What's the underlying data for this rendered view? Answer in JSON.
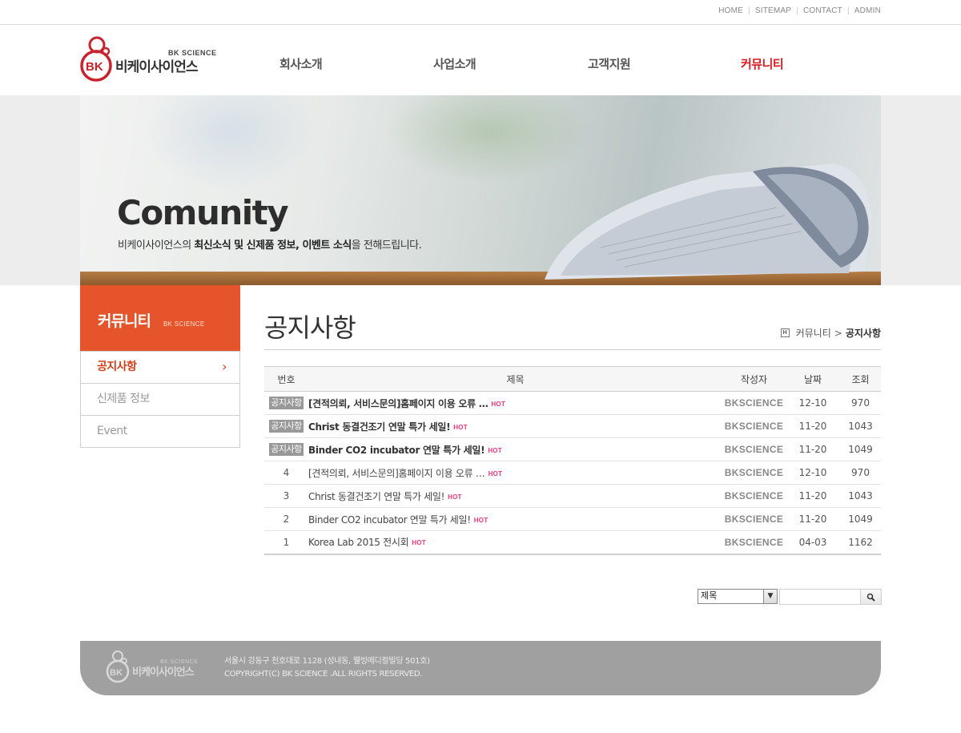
{
  "util_links": [
    "HOME",
    "SITEMAP",
    "CONTACT",
    "ADMIN"
  ],
  "logo": {
    "sub": "BK SCIENCE",
    "ko": "비케이사이언스",
    "mark": "BK"
  },
  "gnb": [
    {
      "label": "회사소개",
      "active": false
    },
    {
      "label": "사업소개",
      "active": false
    },
    {
      "label": "고객지원",
      "active": false
    },
    {
      "label": "커뮤니티",
      "active": true
    }
  ],
  "visual": {
    "title": "Comunity",
    "desc_pre": "비케이사이언스의 ",
    "desc_bold": "최신소식 및 신제품 정보, 이벤트 소식",
    "desc_post": "을 전해드립니다."
  },
  "sidebar": {
    "title_ko": "커뮤니티",
    "title_en": "BK SCIENCE",
    "items": [
      {
        "label": "공지사항",
        "active": true
      },
      {
        "label": "신제품 정보",
        "active": false
      },
      {
        "label": "Event",
        "active": false
      }
    ]
  },
  "content": {
    "title": "공지사항",
    "breadcrumb": {
      "home": "H",
      "parent": "커뮤니티",
      "current": "공지사항"
    }
  },
  "board": {
    "headers": [
      "번호",
      "제목",
      "작성자",
      "날짜",
      "조회"
    ],
    "notice_label": "공지사항",
    "hot_label": "HOT",
    "rows": [
      {
        "num": "공지사항",
        "notice": true,
        "subject": "[견적의뢰, 서비스문의]홈페이지 이용 오류 …",
        "writer": "BKSCIENCE",
        "date": "12-10",
        "views": "970"
      },
      {
        "num": "공지사항",
        "notice": true,
        "subject": "Christ 동결건조기 연말 특가 세일!",
        "writer": "BKSCIENCE",
        "date": "11-20",
        "views": "1043"
      },
      {
        "num": "공지사항",
        "notice": true,
        "subject": "Binder CO2 incubator 연말 특가 세일!",
        "writer": "BKSCIENCE",
        "date": "11-20",
        "views": "1049"
      },
      {
        "num": "4",
        "notice": false,
        "subject": "[견적의뢰, 서비스문의]홈페이지 이용 오류 …",
        "writer": "BKSCIENCE",
        "date": "12-10",
        "views": "970"
      },
      {
        "num": "3",
        "notice": false,
        "subject": "Christ 동결건조기 연말 특가 세일!",
        "writer": "BKSCIENCE",
        "date": "11-20",
        "views": "1043"
      },
      {
        "num": "2",
        "notice": false,
        "subject": "Binder CO2 incubator 연말 특가 세일!",
        "writer": "BKSCIENCE",
        "date": "11-20",
        "views": "1049"
      },
      {
        "num": "1",
        "notice": false,
        "subject": "Korea Lab 2015 전시회",
        "writer": "BKSCIENCE",
        "date": "04-03",
        "views": "1162"
      }
    ]
  },
  "search": {
    "selected": "제목",
    "value": ""
  },
  "footer": {
    "logo_sub": "BK SCIENCE",
    "logo_ko": "비케이사이언스",
    "logo_mark": "BK",
    "address": "서울시 강동구 천호대로 1128 (성내동, 웰빙메디컬빌딩 501호)",
    "copyright": "COPYRIGHT(C) BK SCIENCE .ALL RIGHTS RESERVED."
  },
  "colors": {
    "accent": "#e5542a",
    "gnb_active": "#d81b24",
    "hot": "#e8357a",
    "footer": "#a0a0a0"
  }
}
